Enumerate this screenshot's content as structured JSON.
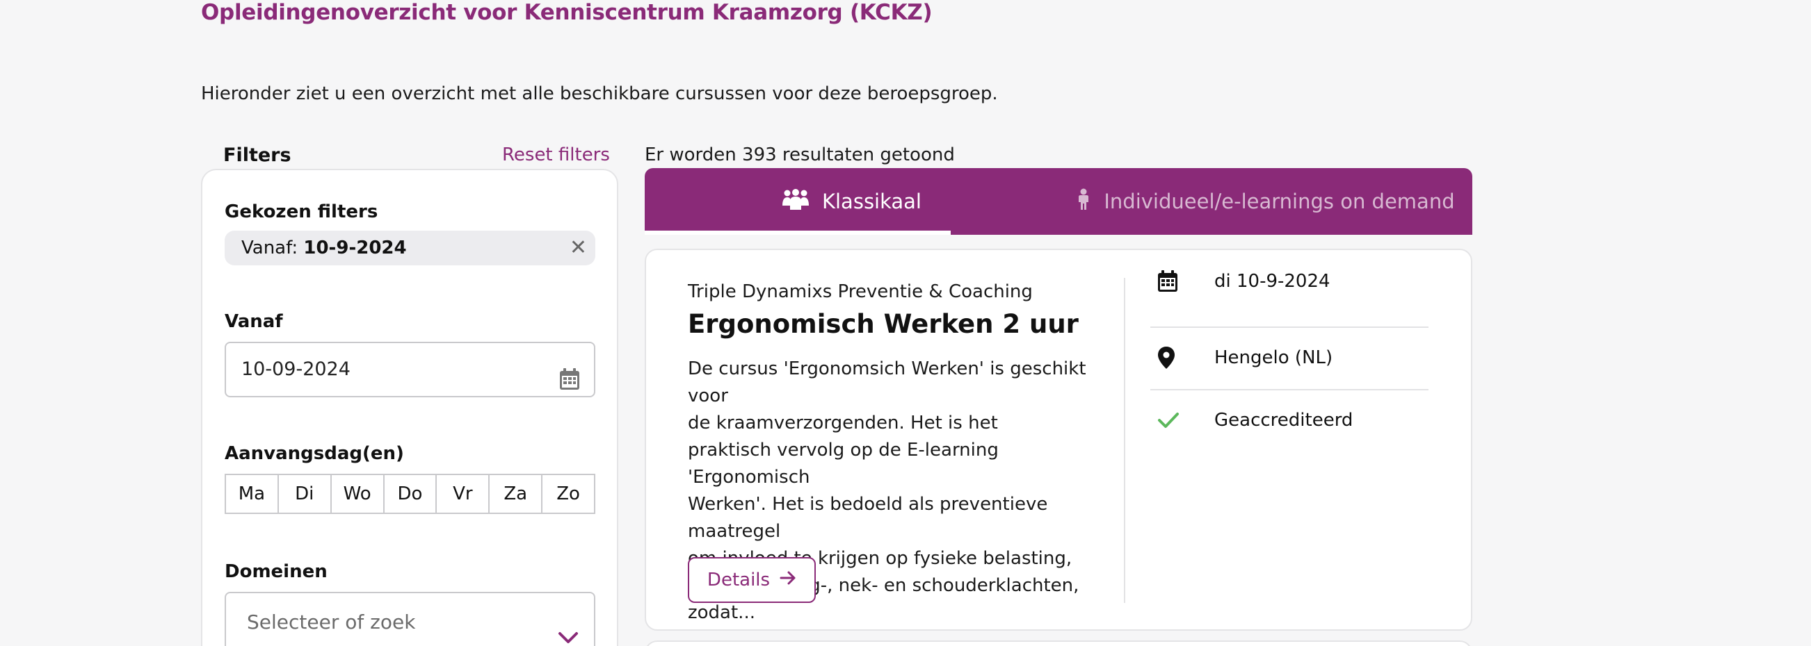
{
  "page": {
    "title": "Opleidingenoverzicht voor Kenniscentrum Kraamzorg (KCKZ)",
    "intro": "Hieronder ziet u een overzicht met alle beschikbare cursussen voor deze beroepsgroep."
  },
  "filters": {
    "label": "Filters",
    "reset_label": "Reset filters",
    "chosen_heading": "Gekozen filters",
    "chip_prefix": "Vanaf:",
    "chip_value": "10-9-2024",
    "from_heading": "Vanaf",
    "from_value": "10-09-2024",
    "days_heading": "Aanvangsdag(en)",
    "days": [
      "Ma",
      "Di",
      "Wo",
      "Do",
      "Vr",
      "Za",
      "Zo"
    ],
    "domains_heading": "Domeinen",
    "domains_placeholder": "Selecteer of zoek"
  },
  "results": {
    "count_text": "Er worden 393 resultaten getoond"
  },
  "tabs": [
    {
      "label": "Klassikaal",
      "icon": "group-icon",
      "active": true
    },
    {
      "label": "Individueel/e-learnings on demand",
      "icon": "person-icon",
      "active": false
    }
  ],
  "course": {
    "provider": "Triple Dynamixs Preventie & Coaching",
    "title": "Ergonomisch Werken 2 uur",
    "description_lines": [
      "De cursus 'Ergonomsich Werken' is geschikt voor",
      "de kraamverzorgenden. Het is het",
      "praktisch vervolg op de E-learning 'Ergonomisch",
      "Werken'. Het is bedoeld als preventieve maatregel",
      "om invloed te krijgen op fysieke belasting,",
      "waaronder rug-, nek- en schouderklachten,",
      "zodat..."
    ],
    "details_label": "Details",
    "date": "di 10-9-2024",
    "location": "Hengelo (NL)",
    "accreditation": "Geaccrediteerd"
  },
  "colors": {
    "brand": "#8a2a78",
    "check": "#5cb85c"
  }
}
